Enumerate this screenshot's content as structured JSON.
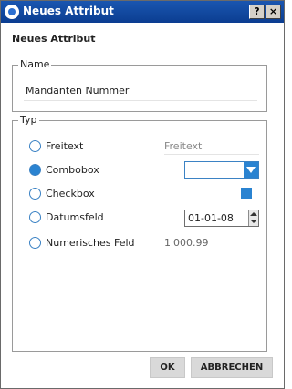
{
  "window": {
    "title": "Neues Attribut",
    "help": "?",
    "close": "×"
  },
  "heading": "Neues Attribut",
  "name_group": {
    "label": "Name",
    "value": "Mandanten Nummer"
  },
  "typ_group": {
    "label": "Typ",
    "options": [
      {
        "label": "Freitext",
        "checked": false
      },
      {
        "label": "Combobox",
        "checked": true
      },
      {
        "label": "Checkbox",
        "checked": false
      },
      {
        "label": "Datumsfeld",
        "checked": false
      },
      {
        "label": "Numerisches Feld",
        "checked": false
      }
    ],
    "freitext_preview": "Freitext",
    "combobox_value": "",
    "checkbox_checked": true,
    "date_value": "01-01-08",
    "numeric_preview": "1'000.99"
  },
  "buttons": {
    "ok": "OK",
    "cancel": "ABBRECHEN"
  },
  "colors": {
    "title_bar": "#0b3d91",
    "accent": "#2a83d1"
  }
}
